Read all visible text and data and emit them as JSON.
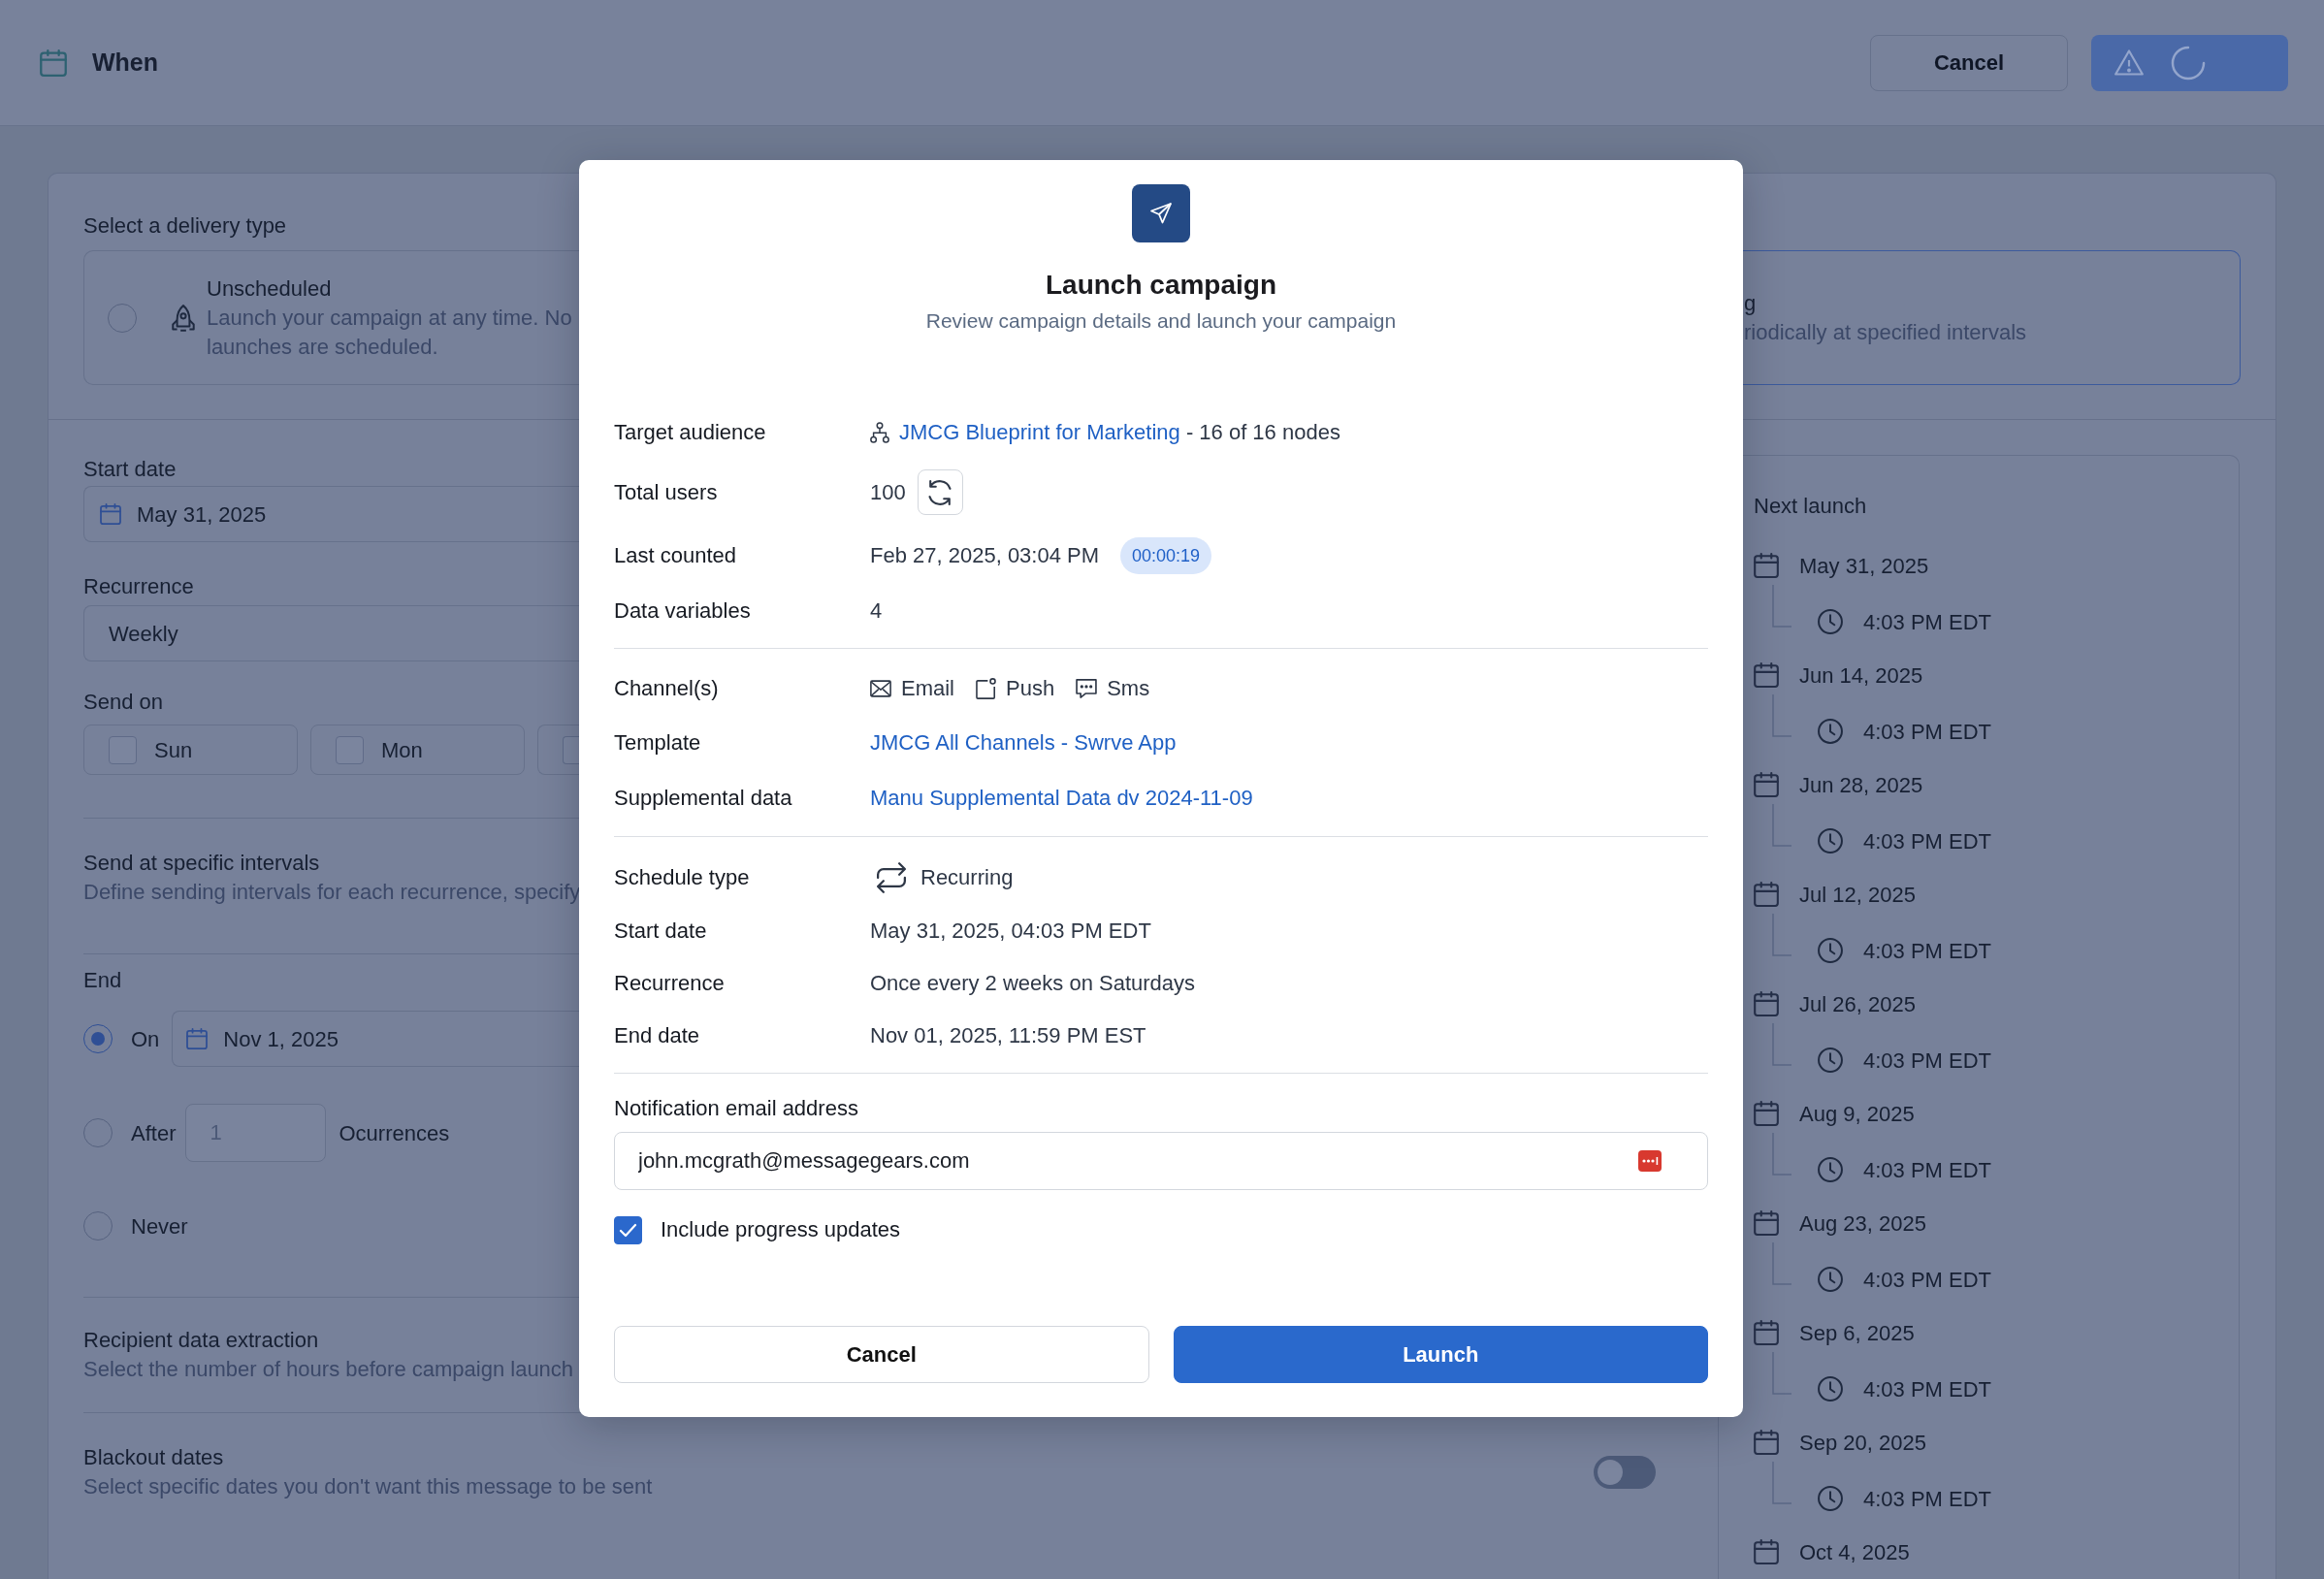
{
  "header": {
    "title": "When",
    "cancel_button": "Cancel",
    "action_button": {
      "warning": true,
      "loading": true
    }
  },
  "delivery_type": {
    "label": "Select a delivery type",
    "options": [
      {
        "title": "Unscheduled",
        "description": "Launch your campaign at any time. No launches are scheduled.",
        "selected": false
      },
      {
        "title": "g",
        "description": "riodically at specified intervals",
        "selected": true
      }
    ]
  },
  "start_date": {
    "label": "Start date",
    "value": "May 31, 2025"
  },
  "recurrence": {
    "label": "Recurrence",
    "value": "Weekly"
  },
  "send_on": {
    "label": "Send on",
    "days": [
      {
        "label": "Sun",
        "checked": false
      },
      {
        "label": "Mon",
        "checked": false
      },
      {
        "checked": false
      }
    ]
  },
  "intervals": {
    "title": "Send at specific intervals",
    "description": "Define sending intervals for each recurrence, specify"
  },
  "end": {
    "label": "End",
    "options": [
      {
        "kind": "date",
        "label": "On",
        "selected": true,
        "value": "Nov 1, 2025"
      },
      {
        "kind": "count",
        "label": "After",
        "selected": false,
        "value": "1",
        "disabled": true,
        "suffix": "Ocurrences"
      },
      {
        "kind": "plain",
        "label": "Never",
        "selected": false
      }
    ]
  },
  "extraction": {
    "title": "Recipient data extraction",
    "description": "Select the number of hours before campaign launch"
  },
  "blackout": {
    "title": "Blackout dates",
    "description": "Select specific dates you don't want this message to be sent",
    "on": false
  },
  "next_launch": {
    "title": "Next launch",
    "launches": [
      {
        "date": "May 31, 2025",
        "time": "4:03 PM EDT"
      },
      {
        "date": "Jun 14, 2025",
        "time": "4:03 PM EDT"
      },
      {
        "date": "Jun 28, 2025",
        "time": "4:03 PM EDT"
      },
      {
        "date": "Jul 12, 2025",
        "time": "4:03 PM EDT"
      },
      {
        "date": "Jul 26, 2025",
        "time": "4:03 PM EDT"
      },
      {
        "date": "Aug 9, 2025",
        "time": "4:03 PM EDT"
      },
      {
        "date": "Aug 23, 2025",
        "time": "4:03 PM EDT"
      },
      {
        "date": "Sep 6, 2025",
        "time": "4:03 PM EDT"
      },
      {
        "date": "Sep 20, 2025",
        "time": "4:03 PM EDT"
      },
      {
        "date": "Oct 4, 2025"
      }
    ]
  },
  "modal": {
    "title": "Launch campaign",
    "subtitle": "Review campaign details and launch your campaign",
    "groups": [
      {
        "rows": [
          {
            "kind": "audience",
            "label": "Target audience",
            "link": "JMCG Blueprint for Marketing",
            "text": "- 16 of 16 nodes"
          },
          {
            "kind": "count",
            "label": "Total users",
            "value": "100"
          },
          {
            "kind": "timestamp",
            "label": "Last counted",
            "value": "Feb 27, 2025, 03:04 PM",
            "badge": "00:00:19"
          },
          {
            "kind": "text",
            "label": "Data variables",
            "value": "4"
          }
        ]
      },
      {
        "rows": [
          {
            "kind": "channels",
            "label": "Channel(s)",
            "channels": [
              {
                "kind": "email",
                "label": "Email"
              },
              {
                "kind": "push",
                "label": "Push"
              },
              {
                "kind": "sms",
                "label": "Sms"
              }
            ]
          },
          {
            "kind": "link",
            "label": "Template",
            "value": "JMCG All Channels - Swrve App"
          },
          {
            "kind": "link",
            "label": "Supplemental data",
            "value": "Manu Supplemental Data dv 2024-11-09"
          }
        ]
      },
      {
        "rows": [
          {
            "kind": "schedule",
            "label": "Schedule type",
            "value": "Recurring"
          },
          {
            "kind": "text",
            "label": "Start date",
            "value": "May 31, 2025, 04:03 PM EDT"
          },
          {
            "kind": "text",
            "label": "Recurrence",
            "value": "Once every 2 weeks on Saturdays"
          },
          {
            "kind": "text",
            "label": "End date",
            "value": "Nov 01, 2025, 11:59 PM EST"
          }
        ]
      }
    ],
    "notification": {
      "label": "Notification email address",
      "value": "john.mcgrath@messagegears.com",
      "include_updates": {
        "label": "Include progress updates",
        "checked": true
      }
    },
    "buttons": {
      "cancel": "Cancel",
      "confirm": "Launch"
    }
  }
}
